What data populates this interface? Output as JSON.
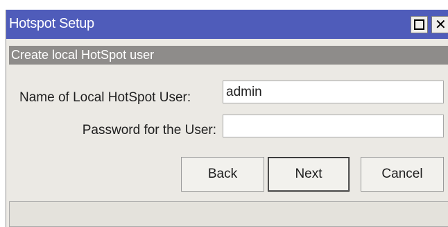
{
  "window": {
    "title": "Hotspot Setup",
    "maximize_icon": "maximize-icon",
    "close_icon": "close-icon",
    "close_glyph": "✕"
  },
  "section": {
    "header": "Create local HotSpot user"
  },
  "form": {
    "user_label": "Name of Local HotSpot User:",
    "user_value": "admin",
    "password_label": "Password for the User:",
    "password_value": ""
  },
  "buttons": {
    "back": "Back",
    "next": "Next",
    "cancel": "Cancel"
  },
  "status": {
    "text": ""
  },
  "colors": {
    "titlebar": "#4f5cba",
    "section_header": "#8e8c8a",
    "window_bg": "#ebe9e4"
  }
}
